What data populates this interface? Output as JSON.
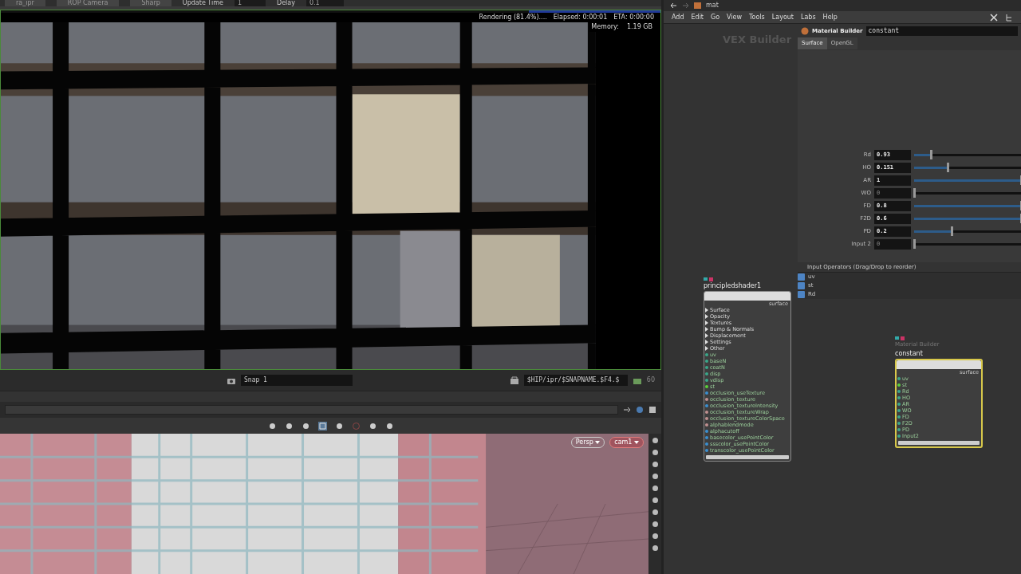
{
  "render_toolbar": {
    "items": [
      {
        "kind": "field",
        "text": "ra_ipr"
      },
      {
        "kind": "field",
        "text": "ROP Camera"
      },
      {
        "kind": "field",
        "text": "Sharp"
      },
      {
        "kind": "label",
        "text": "Update Time"
      },
      {
        "kind": "value",
        "text": "1"
      },
      {
        "kind": "label",
        "text": "Delay"
      },
      {
        "kind": "value",
        "text": "0.1"
      }
    ]
  },
  "render_status": {
    "progress": {
      "level": 0.2
    },
    "status": "Rendering (81.4%)....",
    "elapsed": "Elapsed: 0:00:01",
    "eta": "ETA: 0:00:00",
    "memory_label": "Memory:",
    "memory": "1.19 GB"
  },
  "snap_bar": {
    "snapshot": "Snap 1",
    "path": "$HIP/ipr/$SNAPNAME.$F4.$",
    "frame": "60"
  },
  "viewport": {
    "camera_menus": [
      {
        "label": "Persp",
        "kind": "plain"
      },
      {
        "label": "cam1",
        "kind": "camera"
      }
    ]
  },
  "network": {
    "path": "mat",
    "menu": [
      "Add",
      "Edit",
      "Go",
      "View",
      "Tools",
      "Layout",
      "Labs",
      "Help"
    ],
    "context_label": "VEX Builder"
  },
  "parameters": {
    "node_type": "Material Builder",
    "node_name": "constant",
    "tabs": [
      {
        "label": "Surface",
        "selected": true
      },
      {
        "label": "OpenGL",
        "selected": false
      }
    ],
    "rows": [
      {
        "label": "Rd",
        "value": "0.93",
        "level": 0.16,
        "default": false
      },
      {
        "label": "HO",
        "value": "0.151",
        "level": 0.31,
        "default": false
      },
      {
        "label": "AR",
        "value": "1",
        "level": 1,
        "default": false
      },
      {
        "label": "WO",
        "value": "0",
        "level": 0,
        "default": true
      },
      {
        "label": "FD",
        "value": "0.8",
        "level": 1,
        "default": false
      },
      {
        "label": "F2D",
        "value": "0.6",
        "level": 1,
        "default": false
      },
      {
        "label": "PD",
        "value": "0.2",
        "level": 0.35,
        "default": false
      },
      {
        "label": "Input 2",
        "value": "0",
        "level": 0,
        "default": true
      }
    ],
    "operators_header": "Input Operators (Drag/Drop to reorder)",
    "operators": [
      "uv",
      "st",
      "Rd"
    ]
  },
  "nodes": [
    {
      "kind": "principled",
      "name": "principledshader1",
      "output": "surface",
      "selected": false,
      "inputs": [
        {
          "kind": "folder",
          "label": "Surface"
        },
        {
          "kind": "folder",
          "label": "Opacity"
        },
        {
          "kind": "folder",
          "label": "Textures"
        },
        {
          "kind": "folder",
          "label": "Bump & Normals"
        },
        {
          "kind": "folder",
          "label": "Displacement"
        },
        {
          "kind": "folder",
          "label": "Settings"
        },
        {
          "kind": "folder",
          "label": "Other"
        },
        {
          "kind": "port",
          "label": "uv",
          "color": "#3aa78a"
        },
        {
          "kind": "port",
          "label": "baseN",
          "color": "#3aa78a"
        },
        {
          "kind": "port",
          "label": "coatN",
          "color": "#3aa78a"
        },
        {
          "kind": "port",
          "label": "disp",
          "color": "#3aa78a"
        },
        {
          "kind": "port",
          "label": "vdisp",
          "color": "#3aa78a"
        },
        {
          "kind": "port",
          "label": "st",
          "color": "#5ad03a"
        },
        {
          "kind": "port",
          "label": "occlusion_useTexture",
          "color": "#3a8fd0"
        },
        {
          "kind": "port",
          "label": "occlusion_texture",
          "color": "#c09090"
        },
        {
          "kind": "port",
          "label": "occlusion_textureIntensity",
          "color": "#3a8fd0"
        },
        {
          "kind": "port",
          "label": "occlusion_textureWrap",
          "color": "#c09090"
        },
        {
          "kind": "port",
          "label": "occlusion_textureColorSpace",
          "color": "#c09090"
        },
        {
          "kind": "port",
          "label": "alphablendmode",
          "color": "#c09090"
        },
        {
          "kind": "port",
          "label": "alphacutoff",
          "color": "#3a8fd0"
        },
        {
          "kind": "port",
          "label": "basecolor_usePointColor",
          "color": "#3a8fd0"
        },
        {
          "kind": "port",
          "label": "ssscolor_usePointColor",
          "color": "#3a8fd0"
        },
        {
          "kind": "port",
          "label": "transcolor_usePointColor",
          "color": "#3a8fd0"
        }
      ]
    },
    {
      "kind": "builder",
      "type_label": "Material Builder",
      "name": "constant",
      "output": "surface",
      "selected": true,
      "inputs": [
        {
          "kind": "port",
          "label": "uv",
          "color": "#3aa78a"
        },
        {
          "kind": "port",
          "label": "st",
          "color": "#5ad03a"
        },
        {
          "kind": "port",
          "label": "Rd",
          "color": "#3aa78a"
        },
        {
          "kind": "port",
          "label": "HO",
          "color": "#3aa78a"
        },
        {
          "kind": "port",
          "label": "AR",
          "color": "#3aa78a"
        },
        {
          "kind": "port",
          "label": "WO",
          "color": "#3aa78a"
        },
        {
          "kind": "port",
          "label": "FD",
          "color": "#3aa78a"
        },
        {
          "kind": "port",
          "label": "F2D",
          "color": "#3aa78a"
        },
        {
          "kind": "port",
          "label": "PD",
          "color": "#3aa78a"
        },
        {
          "kind": "port",
          "label": "Input2",
          "color": "#3aa78a"
        }
      ]
    }
  ]
}
